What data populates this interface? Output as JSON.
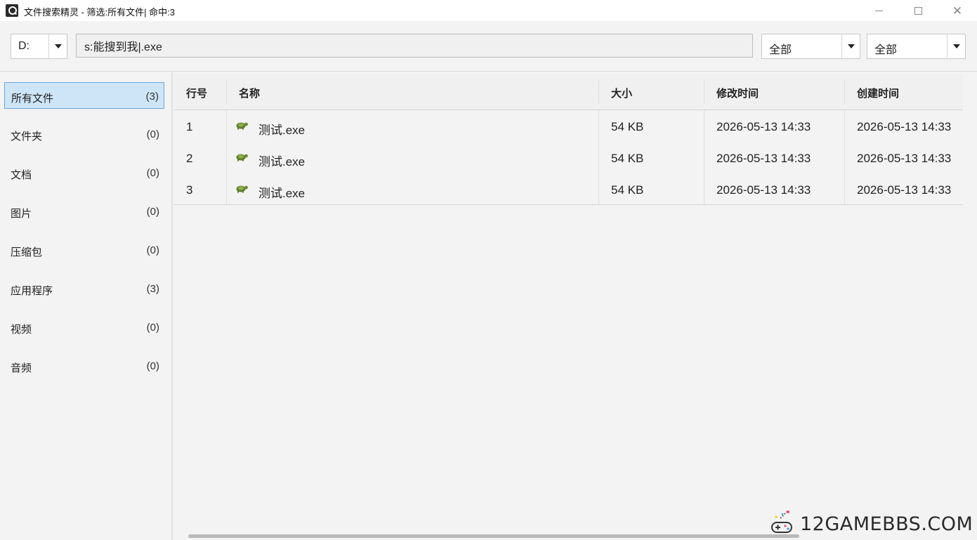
{
  "window": {
    "title": "文件搜索精灵 - 筛选:所有文件| 命中:3"
  },
  "toolbar": {
    "drive": "D:",
    "search_value": "s:能搜到我|.exe",
    "type_filter": "全部",
    "time_filter": "全部"
  },
  "sidebar": {
    "items": [
      {
        "label": "所有文件",
        "count": "(3)"
      },
      {
        "label": "文件夹",
        "count": "(0)"
      },
      {
        "label": "文档",
        "count": "(0)"
      },
      {
        "label": "图片",
        "count": "(0)"
      },
      {
        "label": "压缩包",
        "count": "(0)"
      },
      {
        "label": "应用程序",
        "count": "(3)"
      },
      {
        "label": "视频",
        "count": "(0)"
      },
      {
        "label": "音频",
        "count": "(0)"
      }
    ]
  },
  "table": {
    "columns": [
      "行号",
      "名称",
      "大小",
      "修改时间",
      "创建时间"
    ],
    "rows": [
      {
        "index": "1",
        "name": "测试.exe",
        "size": "54 KB",
        "modified": "2026-05-13 14:33",
        "created": "2026-05-13 14:33"
      },
      {
        "index": "2",
        "name": "测试.exe",
        "size": "54 KB",
        "modified": "2026-05-13 14:33",
        "created": "2026-05-13 14:33"
      },
      {
        "index": "3",
        "name": "测试.exe",
        "size": "54 KB",
        "modified": "2026-05-13 14:33",
        "created": "2026-05-13 14:33"
      }
    ],
    "file_icon": "turtle-app-icon"
  },
  "watermark": {
    "text": "12GAMEBBS.COM"
  },
  "colors": {
    "selected_bg": "#cde5f7",
    "selected_border": "#6aa8d8"
  }
}
